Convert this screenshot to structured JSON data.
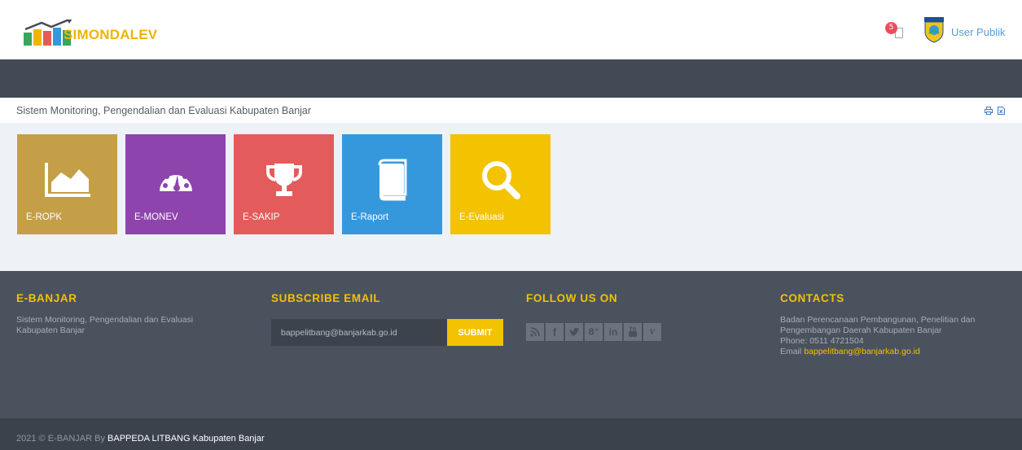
{
  "header": {
    "logo_text": "SIMONDALEV",
    "notification_count": "5",
    "user_name": "User Publik"
  },
  "page_bar": {
    "title": "Sistem Monitoring, Pengendalian dan Evaluasi Kabupaten Banjar",
    "print_icon": "print-icon",
    "export_icon": "export-icon"
  },
  "tiles": [
    {
      "label": "E-ROPK",
      "icon": "area-chart-icon",
      "color": "#c49f47"
    },
    {
      "label": "E-MONEV",
      "icon": "dashboard-icon",
      "color": "#8e44ad"
    },
    {
      "label": "E-SAKIP",
      "icon": "trophy-icon",
      "color": "#e35b5a"
    },
    {
      "label": "E-Raport",
      "icon": "book-icon",
      "color": "#3598dc"
    },
    {
      "label": "E-Evaluasi",
      "icon": "search-icon",
      "color": "#f3c200"
    }
  ],
  "footer": {
    "about": {
      "title": "E-BANJAR",
      "text": "Sistem Monitoring, Pengendalian dan Evaluasi Kabupaten Banjar"
    },
    "subscribe": {
      "title": "SUBSCRIBE EMAIL",
      "input_value": "bappelitbang@banjarkab.go.id",
      "button_label": "SUBMIT"
    },
    "follow": {
      "title": "FOLLOW US ON",
      "icons": [
        "rss-icon",
        "facebook-icon",
        "twitter-icon",
        "google-plus-icon",
        "linkedin-icon",
        "youtube-icon",
        "vimeo-icon"
      ]
    },
    "contacts": {
      "title": "CONTACTS",
      "line1": "Badan Perencanaan Pembangunan, Penelitian dan",
      "line2": "Pengembangan Daerah Kabupaten Banjar",
      "line3": "Phone: 0511 4721504",
      "email_label": "Email",
      "email": "bappelitbang@banjarkab.go.id"
    }
  },
  "copyright": {
    "text": "2021 © E-BANJAR By",
    "link": "BAPPEDA LITBANG Kabupaten Banjar"
  },
  "colors": {
    "navbar": "#424a55",
    "footer": "#4a525e",
    "accent": "#f3c200"
  }
}
